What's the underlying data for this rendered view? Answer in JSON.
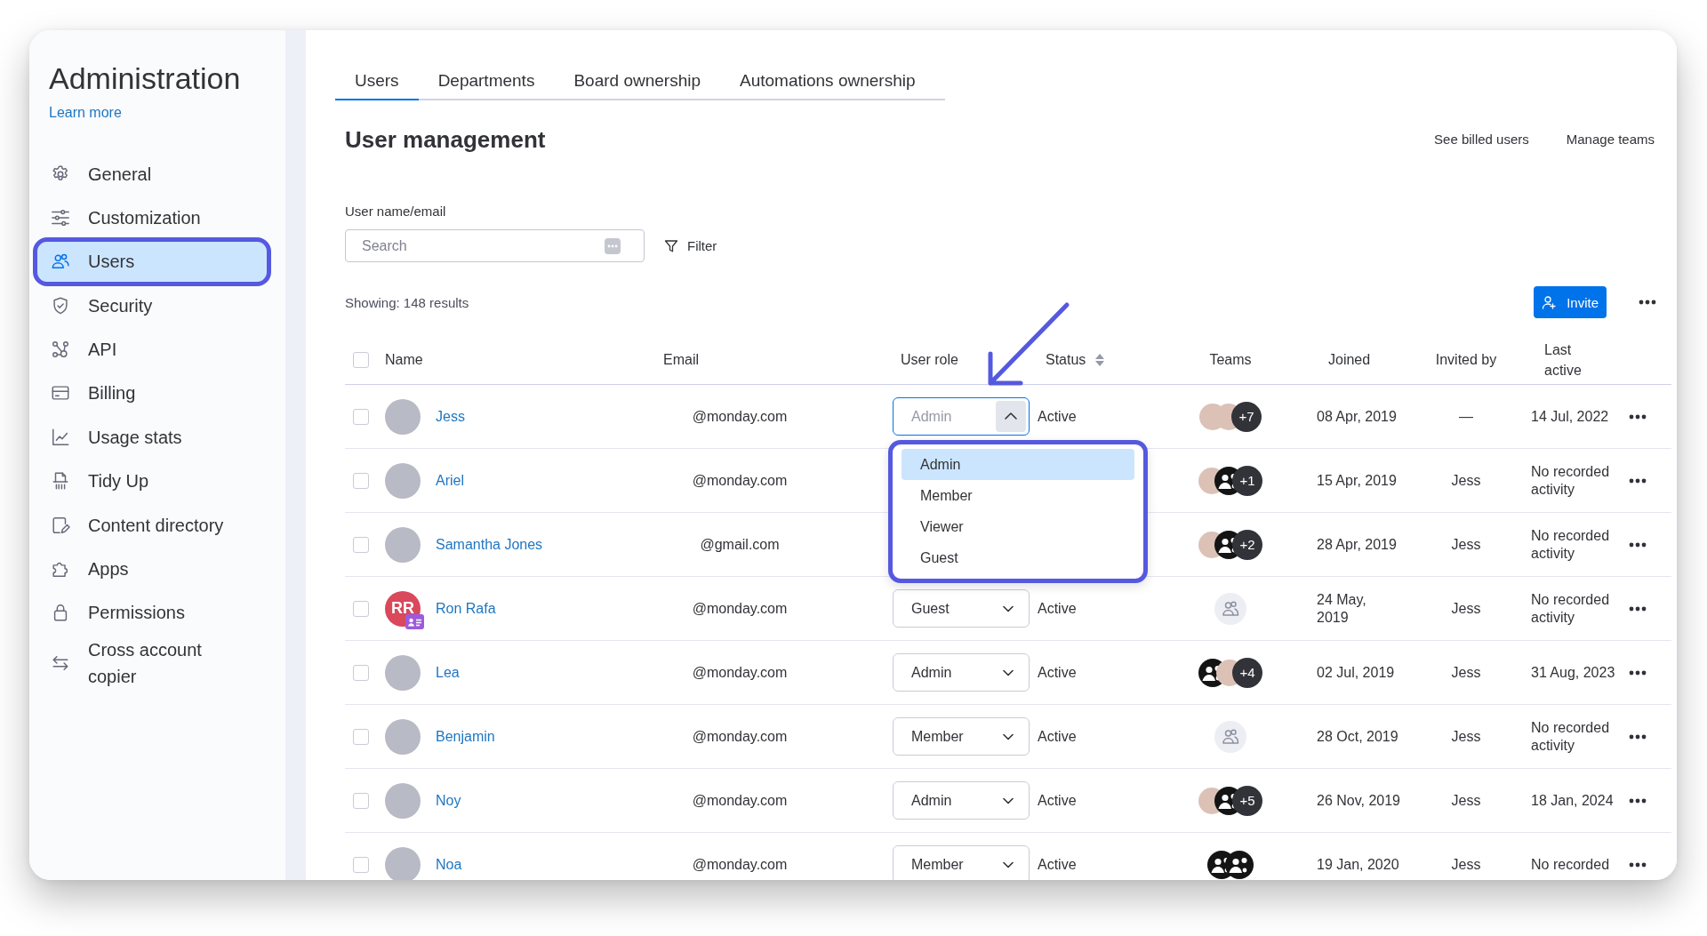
{
  "sidebar": {
    "title": "Administration",
    "link": "Learn more",
    "items": [
      {
        "label": "General",
        "selected": false
      },
      {
        "label": "Customization",
        "selected": false
      },
      {
        "label": "Users",
        "selected": true
      },
      {
        "label": "Security",
        "selected": false
      },
      {
        "label": "API",
        "selected": false
      },
      {
        "label": "Billing",
        "selected": false
      },
      {
        "label": "Usage stats",
        "selected": false
      },
      {
        "label": "Tidy Up",
        "selected": false
      },
      {
        "label": "Content directory",
        "selected": false
      },
      {
        "label": "Apps",
        "selected": false
      },
      {
        "label": "Permissions",
        "selected": false
      },
      {
        "label": "Cross account copier",
        "selected": false
      }
    ]
  },
  "tabs": [
    {
      "label": "Users",
      "selected": true
    },
    {
      "label": "Departments",
      "selected": false
    },
    {
      "label": "Board ownership",
      "selected": false
    },
    {
      "label": "Automations ownership",
      "selected": false
    }
  ],
  "header": {
    "title": "User management",
    "links": [
      "See billed users",
      "Manage teams"
    ]
  },
  "search": {
    "label": "User name/email",
    "placeholder": "Search"
  },
  "toolbar": {
    "filter": "Filter",
    "results": "Showing: 148 results",
    "invite": "Invite"
  },
  "table": {
    "select_all": {
      "checked": false
    },
    "columns": [
      "Name",
      "Email",
      "User role",
      "Status",
      "Teams",
      "Joined",
      "Invited by",
      "Last active"
    ],
    "rows": [
      {
        "checked": false,
        "avatar": {
          "kind": "photo"
        },
        "name": "Jess",
        "email": "@monday.com",
        "role": {
          "value": "Admin",
          "open": true,
          "options": [
            {
              "label": "Admin",
              "selected": true
            },
            {
              "label": "Member",
              "selected": false
            },
            {
              "label": "Viewer",
              "selected": false
            },
            {
              "label": "Guest",
              "selected": false
            }
          ]
        },
        "status": "Active",
        "teams": {
          "avatars": [
            {
              "kind": "photo"
            },
            {
              "kind": "photo"
            }
          ],
          "count": "+7"
        },
        "joined": "08 Apr, 2019",
        "invited_by": "—",
        "last_active": "14 Jul, 2022"
      },
      {
        "checked": false,
        "avatar": {
          "kind": "photo"
        },
        "name": "Ariel",
        "email": "@monday.com",
        "teams": {
          "avatars": [
            {
              "kind": "photo"
            },
            {
              "kind": "logo"
            }
          ],
          "count": "+1"
        },
        "joined": "15 Apr, 2019",
        "invited_by": "Jess",
        "last_active": "No recorded activity"
      },
      {
        "checked": false,
        "avatar": {
          "kind": "photo"
        },
        "name": "Samantha Jones",
        "email": "@gmail.com",
        "teams": {
          "avatars": [
            {
              "kind": "photo"
            },
            {
              "kind": "logo"
            }
          ],
          "count": "+2"
        },
        "joined": "28 Apr, 2019",
        "invited_by": "Jess",
        "last_active": "No recorded activity"
      },
      {
        "checked": false,
        "avatar": {
          "kind": "initials",
          "initials": "RR",
          "color": "#d9485b",
          "guest_badge": true
        },
        "name": "Ron Rafa",
        "email": "@monday.com",
        "role": {
          "value": "Guest",
          "open": false
        },
        "status": "Active",
        "joined": "24 May, 2019",
        "invited_by": "Jess",
        "last_active": "No recorded activity"
      },
      {
        "checked": false,
        "avatar": {
          "kind": "photo"
        },
        "name": "Lea",
        "email": "@monday.com",
        "role": {
          "value": "Admin",
          "open": false
        },
        "status": "Active",
        "teams": {
          "avatars": [
            {
              "kind": "logo"
            },
            {
              "kind": "photo"
            }
          ],
          "count": "+4"
        },
        "joined": "02 Jul, 2019",
        "invited_by": "Jess",
        "last_active": "31 Aug, 2023"
      },
      {
        "checked": false,
        "avatar": {
          "kind": "photo"
        },
        "name": "Benjamin",
        "email": "@monday.com",
        "role": {
          "value": "Member",
          "open": false
        },
        "status": "Active",
        "joined": "28 Oct, 2019",
        "invited_by": "Jess",
        "last_active": "No recorded activity"
      },
      {
        "checked": false,
        "avatar": {
          "kind": "photo"
        },
        "name": "Noy",
        "email": "@monday.com",
        "role": {
          "value": "Admin",
          "open": false
        },
        "status": "Active",
        "teams": {
          "avatars": [
            {
              "kind": "photo"
            },
            {
              "kind": "logo"
            }
          ],
          "count": "+5"
        },
        "joined": "26 Nov, 2019",
        "invited_by": "Jess",
        "last_active": "18 Jan, 2024"
      },
      {
        "checked": false,
        "avatar": {
          "kind": "photo"
        },
        "name": "Noa",
        "email": "@monday.com",
        "role": {
          "value": "Member",
          "open": false
        },
        "status": "Active",
        "teams": {
          "avatars": [
            {
              "kind": "logo"
            },
            {
              "kind": "logo"
            }
          ]
        },
        "joined": "19 Jan, 2020",
        "invited_by": "Jess",
        "last_active": "No recorded"
      }
    ]
  }
}
